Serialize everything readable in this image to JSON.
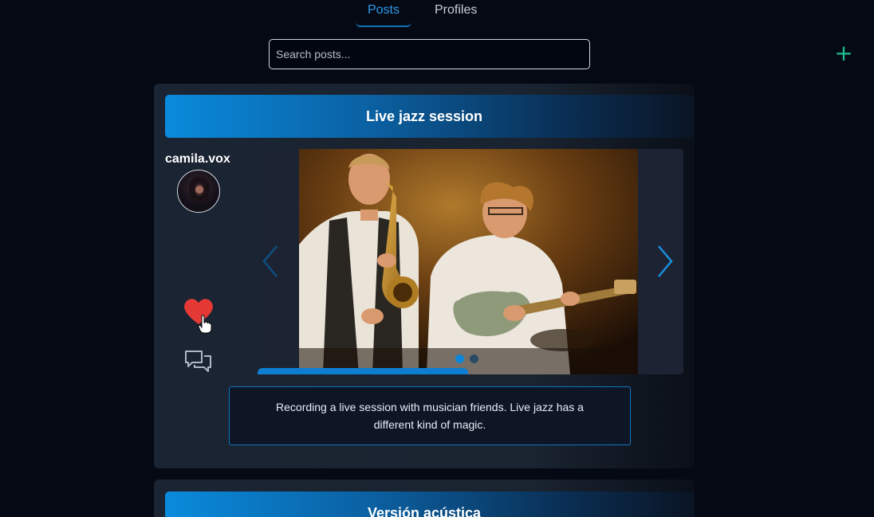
{
  "nav": {
    "tabs": [
      {
        "label": "Posts",
        "active": true
      },
      {
        "label": "Profiles",
        "active": false
      }
    ]
  },
  "search": {
    "placeholder": "Search posts...",
    "value": ""
  },
  "add_button": {
    "icon": "plus-icon",
    "color": "#1fbf8c"
  },
  "posts": [
    {
      "title": "Live jazz session",
      "username": "camila.vox",
      "liked": true,
      "media_count": 2,
      "active_media_index": 0,
      "caption": "Recording a live session with musician friends. Live jazz has a different kind of magic."
    },
    {
      "title": "Versión acústica"
    }
  ],
  "colors": {
    "accent": "#0b86d8",
    "background": "#050914",
    "like": "#e53935",
    "add": "#1fbf8c"
  }
}
